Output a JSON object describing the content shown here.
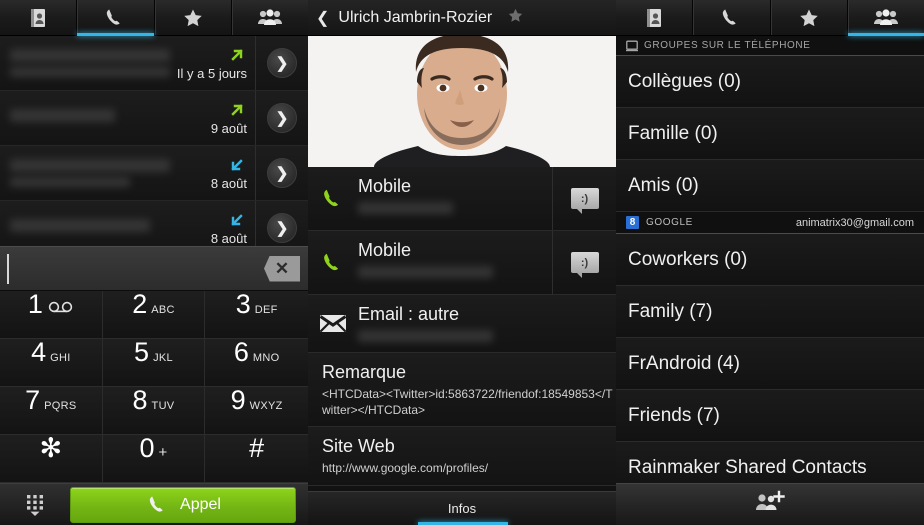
{
  "tabs": [
    {
      "icon": "contacts-book-icon",
      "name": "tab-contacts"
    },
    {
      "icon": "phone-handset-icon",
      "name": "tab-phone"
    },
    {
      "icon": "star-icon",
      "name": "tab-favorites"
    },
    {
      "icon": "groups-people-icon",
      "name": "tab-groups"
    }
  ],
  "left_panel": {
    "active_tab_index": 1,
    "call_log": [
      {
        "date": "Il y a 5 jours",
        "direction": "outgoing",
        "name_redacted": true,
        "has_subtitle": true
      },
      {
        "date": "9 août",
        "direction": "outgoing",
        "name_redacted": true,
        "has_subtitle": false
      },
      {
        "date": "8 août",
        "direction": "incoming",
        "name_redacted": true,
        "has_subtitle": true
      },
      {
        "date": "8 août",
        "direction": "incoming",
        "name_redacted": true,
        "has_subtitle": false
      }
    ],
    "dialer": {
      "input_value": "",
      "backspace_glyph": "✕",
      "keys": [
        {
          "digit": "1",
          "sub": "",
          "voicemail": true
        },
        {
          "digit": "2",
          "sub": "ABC"
        },
        {
          "digit": "3",
          "sub": "DEF"
        },
        {
          "digit": "4",
          "sub": "GHI"
        },
        {
          "digit": "5",
          "sub": "JKL"
        },
        {
          "digit": "6",
          "sub": "MNO"
        },
        {
          "digit": "7",
          "sub": "PQRS"
        },
        {
          "digit": "8",
          "sub": "TUV"
        },
        {
          "digit": "9",
          "sub": "WXYZ"
        },
        {
          "digit": "✻",
          "sub": ""
        },
        {
          "digit": "0",
          "sub": "+"
        },
        {
          "digit": "#",
          "sub": ""
        }
      ],
      "call_button_label": "Appel",
      "keypad_icon": "dialpad-icon"
    }
  },
  "middle_panel": {
    "back_glyph": "❮",
    "contact_name": "Ulrich Jambrin-Rozier",
    "favorite_icon": "star-icon",
    "photo_alt": "contact-photo",
    "rows": [
      {
        "label": "Mobile",
        "value_redacted": true,
        "icon": "phone-handset-icon",
        "action_icon": "sms-icon",
        "action_glyph": ":)"
      },
      {
        "label": "Mobile",
        "value_redacted": true,
        "icon": "phone-handset-icon",
        "action_icon": "sms-icon",
        "action_glyph": ":)"
      },
      {
        "label": "Email : autre",
        "value_redacted": true,
        "icon": "envelope-icon"
      }
    ],
    "blocks": [
      {
        "title": "Remarque",
        "value": "<HTCData><Twitter>id:5863722/friendof:18549853</Twitter></HTCData>"
      },
      {
        "title": "Site Web",
        "value": "http://www.google.com/profiles/"
      }
    ],
    "footer_tab_label": "Infos"
  },
  "right_panel": {
    "active_tab_index": 3,
    "sections": [
      {
        "type": "header",
        "icon": "phone-device-icon",
        "label": "GROUPES SUR LE TÉLÉPHONE"
      },
      {
        "type": "group",
        "label": "Collègues (0)"
      },
      {
        "type": "group",
        "label": "Famille (0)"
      },
      {
        "type": "group",
        "label": "Amis (0)"
      },
      {
        "type": "account",
        "badge": "8",
        "provider": "GOOGLE",
        "email": "animatrix30@gmail.com"
      },
      {
        "type": "group",
        "label": "Coworkers (0)"
      },
      {
        "type": "group",
        "label": "Family (7)"
      },
      {
        "type": "group",
        "label": "FrAndroid (4)"
      },
      {
        "type": "group",
        "label": "Friends (7)"
      },
      {
        "type": "group",
        "label": "Rainmaker Shared Contacts",
        "clipped": true
      }
    ],
    "footer_icon": "add-group-icon"
  },
  "colors": {
    "accent_blue": "#33b5e5",
    "call_green": "#7fc616",
    "outgoing_arrow": "#8fd41c",
    "incoming_arrow": "#33b5e5",
    "google_blue": "#2a6fd6",
    "background": "#121212"
  }
}
